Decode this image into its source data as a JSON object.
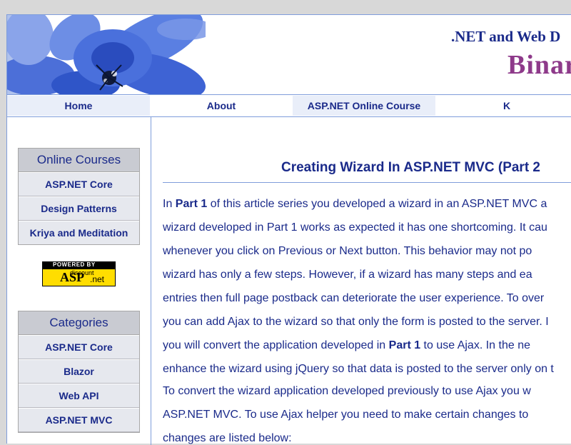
{
  "header": {
    "tagline": ".NET and Web D",
    "brand": "Binar"
  },
  "nav": {
    "items": [
      "Home",
      "About",
      "ASP.NET Online Course",
      "K"
    ]
  },
  "sidebar": {
    "online_courses": {
      "title": "Online Courses",
      "items": [
        "ASP.NET Core",
        "Design Patterns",
        "Kriya and Meditation"
      ]
    },
    "badge": {
      "powered": "POWERED BY",
      "discount": "discount",
      "asp": "ASP",
      "net": ".net"
    },
    "categories": {
      "title": "Categories",
      "items": [
        "ASP.NET Core",
        "Blazor",
        "Web API",
        "ASP.NET MVC"
      ]
    }
  },
  "article": {
    "title": "Creating Wizard In ASP.NET MVC (Part 2",
    "p1": {
      "l1_pre": "In ",
      "l1_link": "Part 1",
      "l1_post": " of this article series you developed a wizard in an ASP.NET MVC a",
      "l2": "wizard developed in Part 1 works as expected it has one shortcoming. It cau",
      "l3": "whenever you click on Previous or Next button. This behavior may not po",
      "l4": "wizard has only a few steps. However, if a wizard has many steps and ea",
      "l5": "entries then full page postback can deteriorate the user experience. To over",
      "l6": "you can add Ajax to the wizard so that only the form is posted to the server. I",
      "l7_pre": "you will convert the application developed in ",
      "l7_link": "Part 1",
      "l7_post": " to use Ajax. In the ne",
      "l8": "enhance the wizard using jQuery so that data is posted to the server only on t"
    },
    "p2": {
      "l1": "To convert the wizard application developed previously to use Ajax you w",
      "l2": "ASP.NET MVC. To use Ajax helper you need to make certain changes to",
      "l3": "changes are listed below:"
    }
  },
  "colors": {
    "accent": "#1a2a8a",
    "border": "#7f9ddb",
    "nav_alt": "#e9eef9",
    "brand": "#8e3a8a"
  }
}
